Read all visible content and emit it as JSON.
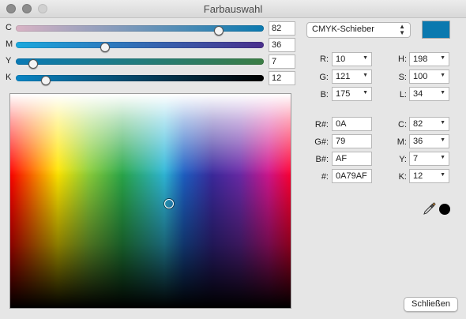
{
  "window": {
    "title": "Farbauswahl"
  },
  "sliders": [
    {
      "key": "c",
      "label": "C",
      "value": "82",
      "fraction": 0.82
    },
    {
      "key": "m",
      "label": "M",
      "value": "36",
      "fraction": 0.36
    },
    {
      "key": "y",
      "label": "Y",
      "value": "7",
      "fraction": 0.07
    },
    {
      "key": "k",
      "label": "K",
      "value": "12",
      "fraction": 0.12
    }
  ],
  "mode": {
    "selected": "CMYK-Schieber"
  },
  "swatch": {
    "color": "#0A79AF"
  },
  "rgb": {
    "r_label": "R:",
    "r_value": "10",
    "g_label": "G:",
    "g_value": "121",
    "b_label": "B:",
    "b_value": "175"
  },
  "hsl": {
    "h_label": "H:",
    "h_value": "198",
    "s_label": "S:",
    "s_value": "100",
    "l_label": "L:",
    "l_value": "34"
  },
  "hex": {
    "r_label": "R#:",
    "r_value": "0A",
    "g_label": "G#:",
    "g_value": "79",
    "b_label": "B#:",
    "b_value": "AF",
    "full_label": "#:",
    "full_value": "0A79AF"
  },
  "cmyk": {
    "c_label": "C:",
    "c_value": "82",
    "m_label": "M:",
    "m_value": "36",
    "y_label": "Y:",
    "y_value": "7",
    "k_label": "K:",
    "k_value": "12"
  },
  "buttons": {
    "close": "Schließen"
  }
}
